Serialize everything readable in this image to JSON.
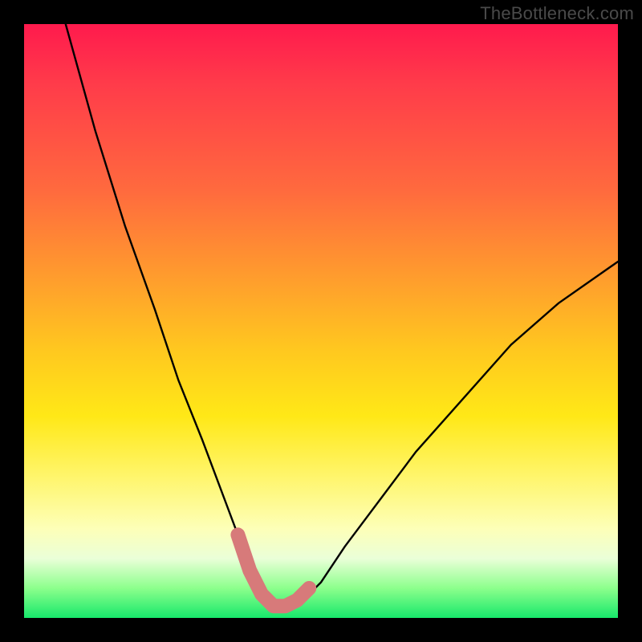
{
  "watermark": "TheBottleneck.com",
  "chart_data": {
    "type": "line",
    "title": "",
    "xlabel": "",
    "ylabel": "",
    "xlim": [
      0,
      100
    ],
    "ylim": [
      0,
      100
    ],
    "series": [
      {
        "name": "bottleneck-curve",
        "x": [
          7,
          12,
          17,
          22,
          26,
          30,
          33,
          36,
          38,
          40,
          42,
          44,
          47,
          50,
          54,
          60,
          66,
          74,
          82,
          90,
          100
        ],
        "y": [
          100,
          82,
          66,
          52,
          40,
          30,
          22,
          14,
          8,
          4,
          2,
          2,
          3,
          6,
          12,
          20,
          28,
          37,
          46,
          53,
          60
        ]
      }
    ],
    "highlight": {
      "name": "optimal-band",
      "x": [
        36,
        38,
        40,
        42,
        44,
        46,
        48
      ],
      "y": [
        14,
        8,
        4,
        2,
        2,
        3,
        5
      ]
    },
    "gradient_bands": [
      {
        "label": "bad-high",
        "color": "#ff1a4d",
        "y_from": 60,
        "y_to": 100
      },
      {
        "label": "warn",
        "color": "#ffca1f",
        "y_from": 20,
        "y_to": 60
      },
      {
        "label": "good",
        "color": "#17e86b",
        "y_from": 0,
        "y_to": 8
      }
    ]
  }
}
